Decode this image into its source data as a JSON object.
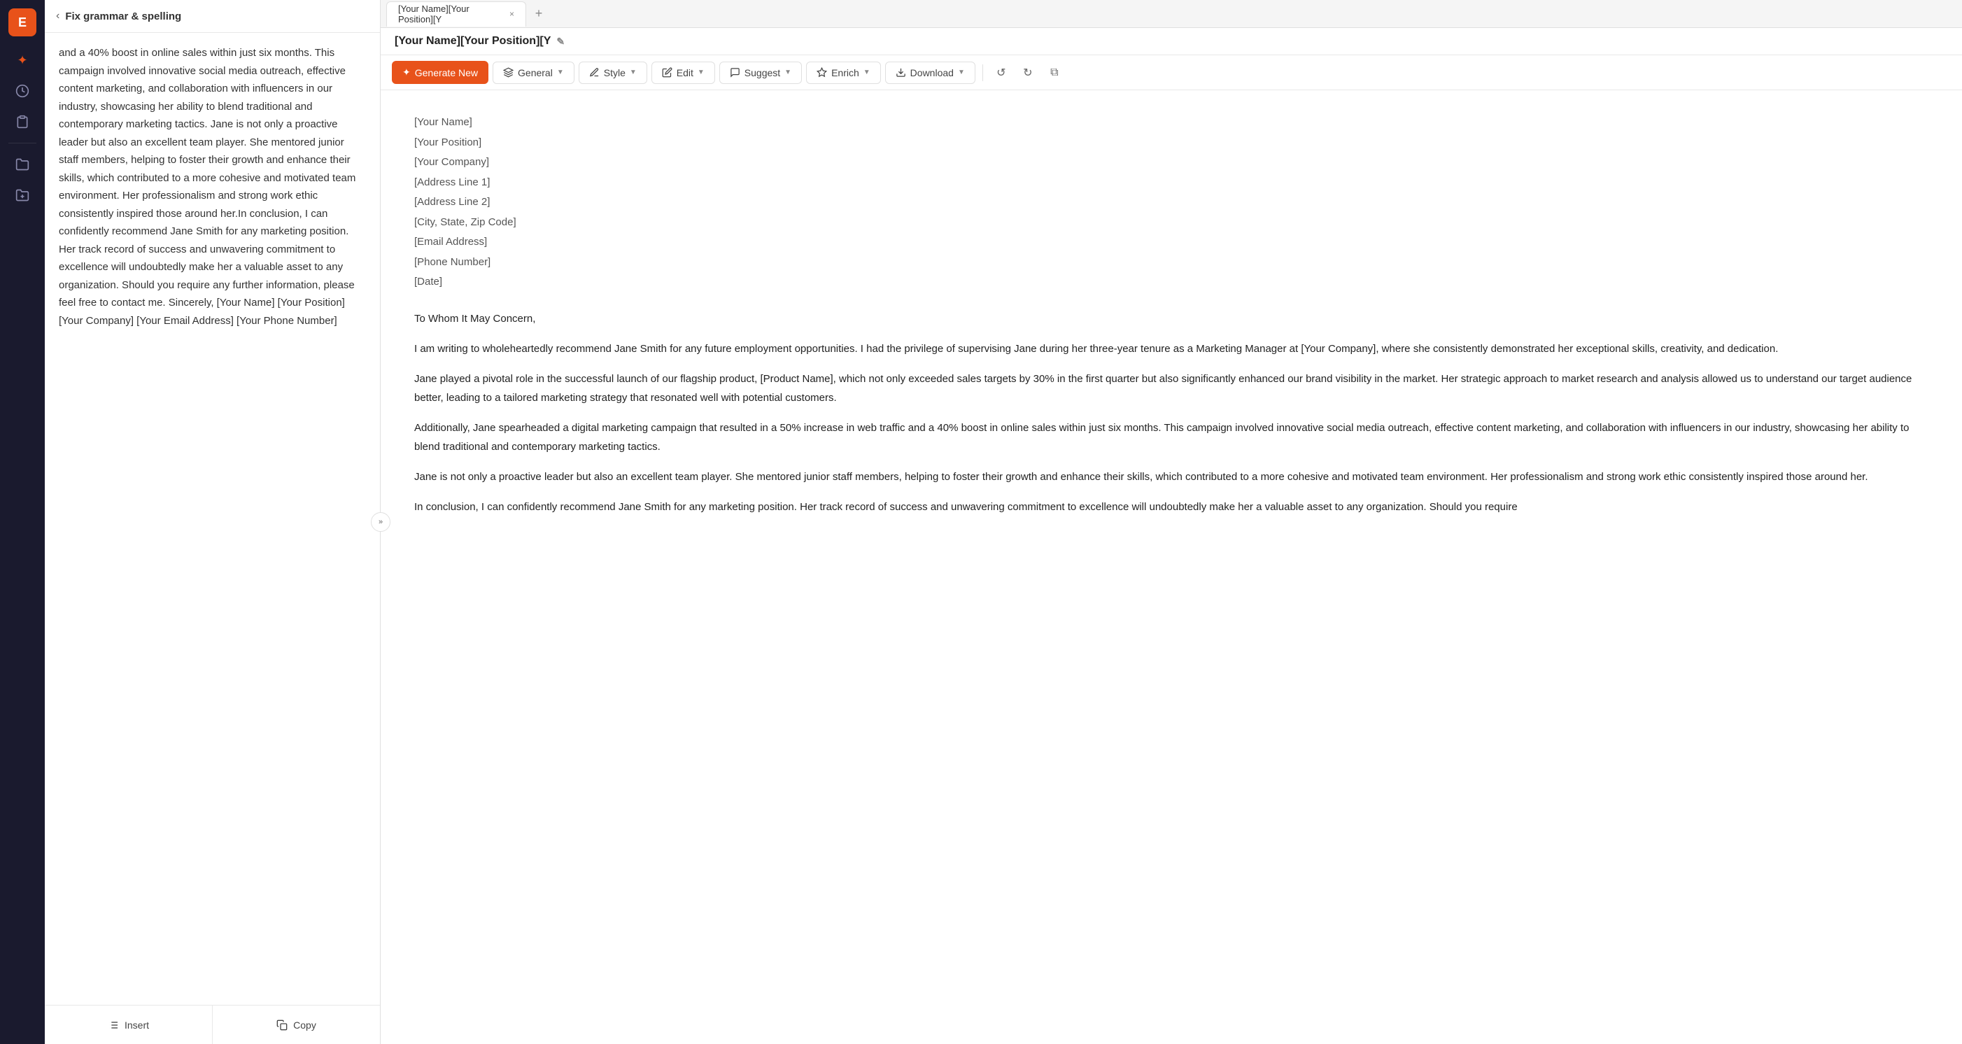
{
  "sidebar": {
    "logo": "E",
    "icons": [
      {
        "name": "magic-icon",
        "symbol": "✦",
        "active": true
      },
      {
        "name": "history-icon",
        "symbol": "🕐",
        "active": false
      },
      {
        "name": "files-icon",
        "symbol": "📋",
        "active": false
      },
      {
        "name": "folder-icon",
        "symbol": "📁",
        "active": false
      },
      {
        "name": "folder2-icon",
        "symbol": "📂",
        "active": false
      }
    ]
  },
  "left_panel": {
    "back_label": "‹",
    "title": "Fix grammar & spelling",
    "content": "and a 40% boost in online sales within just six months. This campaign involved innovative social media outreach, effective content marketing, and collaboration with influencers in our industry, showcasing her ability to blend traditional and contemporary marketing tactics. Jane is not only a proactive leader but also an excellent team player. She mentored junior staff members, helping to foster their growth and enhance their skills, which contributed to a more cohesive and motivated team environment. Her professionalism and strong work ethic consistently inspired those around her.In conclusion, I can confidently recommend Jane Smith for any marketing position. Her track record of success and unwavering commitment to excellence will undoubtedly make her a valuable asset to any organization. Should you require any further information, please feel free to contact me. Sincerely, [Your Name] [Your Position] [Your Company] [Your Email Address] [Your Phone Number]",
    "insert_label": "Insert",
    "copy_label": "Copy"
  },
  "tab_bar": {
    "tab_label": "[Your Name][Your Position][Y",
    "close_symbol": "×",
    "add_symbol": "+"
  },
  "document": {
    "title": "[Your Name][Your Position][Y",
    "edit_icon": "✎",
    "toolbar": {
      "generate_label": "Generate New",
      "generate_icon": "✦",
      "general_label": "General",
      "style_label": "Style",
      "edit_label": "Edit",
      "suggest_label": "Suggest",
      "enrich_label": "Enrich",
      "download_label": "Download",
      "undo_symbol": "↺",
      "redo_symbol": "↻",
      "copy_symbol": "⧉"
    },
    "address": {
      "name": "[Your Name]",
      "position": "[Your Position]",
      "company": "[Your Company]",
      "address1": "[Address Line 1]",
      "address2": "[Address Line 2]",
      "city": "[City, State, Zip Code]",
      "email": "[Email Address]",
      "phone": "[Phone Number]",
      "date": "[Date]"
    },
    "salutation": "To Whom It May Concern,",
    "paragraphs": [
      "I am writing to wholeheartedly recommend Jane Smith for any future employment opportunities. I had the privilege of supervising Jane during her three-year tenure as a Marketing Manager at [Your Company], where she consistently demonstrated her exceptional skills, creativity, and dedication.",
      "Jane played a pivotal role in the successful launch of our flagship product, [Product Name], which not only exceeded sales targets by 30% in the first quarter but also significantly enhanced our brand visibility in the market. Her strategic approach to market research and analysis allowed us to understand our target audience better, leading to a tailored marketing strategy that resonated well with potential customers.",
      "Additionally, Jane spearheaded a digital marketing campaign that resulted in a 50% increase in web traffic and a 40% boost in online sales within just six months. This campaign involved innovative social media outreach, effective content marketing, and collaboration with influencers in our industry, showcasing her ability to blend traditional and contemporary marketing tactics.",
      "Jane is not only a proactive leader but also an excellent team player. She mentored junior staff members, helping to foster their growth and enhance their skills, which contributed to a more cohesive and motivated team environment. Her professionalism and strong work ethic consistently inspired those around her.",
      "In conclusion, I can confidently recommend Jane Smith for any marketing position. Her track record of success and unwavering commitment to excellence will undoubtedly make her a valuable asset to any organization. Should you require"
    ]
  }
}
